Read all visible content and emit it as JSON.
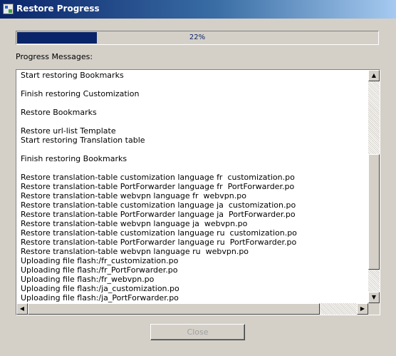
{
  "window": {
    "title": "Restore Progress"
  },
  "progress": {
    "percent_label": "22%",
    "value": 0.22
  },
  "messages_label": "Progress Messages:",
  "messages": [
    "Start restoring Bookmarks",
    "",
    "Finish restoring Customization",
    "",
    "Restore Bookmarks",
    "",
    "Restore url-list Template",
    "Start restoring Translation table",
    "",
    "Finish restoring Bookmarks",
    "",
    "Restore translation-table customization language fr  customization.po",
    "Restore translation-table PortForwarder language fr  PortForwarder.po",
    "Restore translation-table webvpn language fr  webvpn.po",
    "Restore translation-table customization language ja  customization.po",
    "Restore translation-table PortForwarder language ja  PortForwarder.po",
    "Restore translation-table webvpn language ja  webvpn.po",
    "Restore translation-table customization language ru  customization.po",
    "Restore translation-table PortForwarder language ru  PortForwarder.po",
    "Restore translation-table webvpn language ru  webvpn.po",
    "Uploading file flash:/fr_customization.po",
    "Uploading file flash:/fr_PortForwarder.po",
    "Uploading file flash:/fr_webvpn.po",
    "Uploading file flash:/ja_customization.po",
    "Uploading file flash:/ja_PortForwarder.po"
  ],
  "close_button": {
    "label": "Close",
    "enabled": false
  }
}
